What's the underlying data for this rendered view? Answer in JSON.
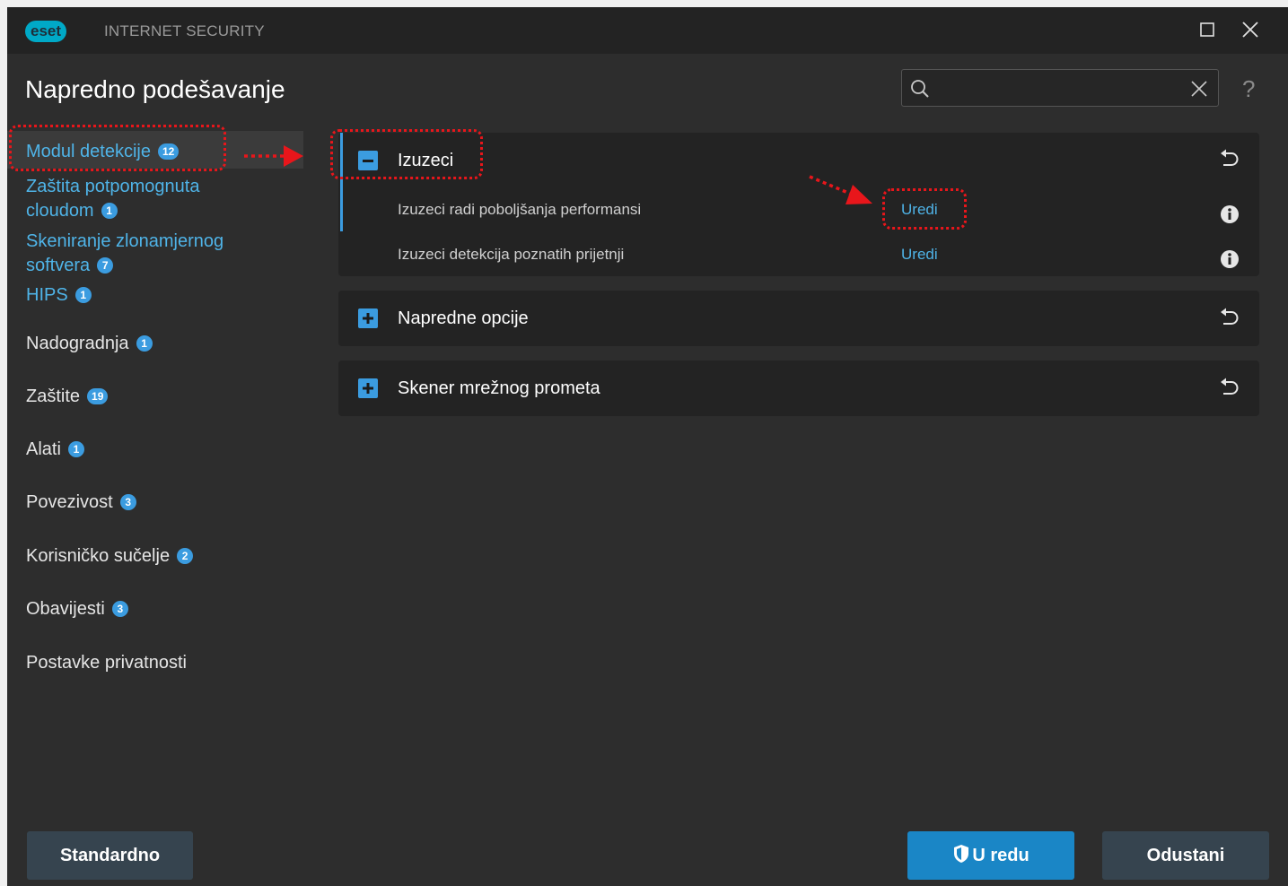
{
  "titlebar": {
    "logo_text": "eset",
    "product_name": "INTERNET SECURITY"
  },
  "header": {
    "title": "Napredno podešavanje",
    "search": {
      "value": "",
      "placeholder": ""
    },
    "help_label": "?"
  },
  "sidebar": {
    "items": [
      {
        "label": "Modul detekcije",
        "badge": "12",
        "active": true
      },
      {
        "label": "Zaštita potpomognuta",
        "label2": "cloudom",
        "badge": "1"
      },
      {
        "label": "Skeniranje zlonamjernog",
        "label2": "softvera",
        "badge": "7"
      },
      {
        "label": "HIPS",
        "badge": "1"
      },
      {
        "label": "Nadogradnja",
        "badge": "1"
      },
      {
        "label": "Zaštite",
        "badge": "19"
      },
      {
        "label": "Alati",
        "badge": "1"
      },
      {
        "label": "Povezivost",
        "badge": "3"
      },
      {
        "label": "Korisničko sučelje",
        "badge": "2"
      },
      {
        "label": "Obavijesti",
        "badge": "3"
      },
      {
        "label": "Postavke privatnosti",
        "badge": ""
      }
    ]
  },
  "sections": [
    {
      "title": "Izuzeci",
      "expanded": true,
      "rows": [
        {
          "label": "Izuzeci radi poboljšanja performansi",
          "action": "Uredi"
        },
        {
          "label": "Izuzeci detekcija poznatih prijetnji",
          "action": "Uredi"
        }
      ]
    },
    {
      "title": "Napredne opcije",
      "expanded": false
    },
    {
      "title": "Skener mrežnog prometa",
      "expanded": false
    }
  ],
  "footer": {
    "default_label": "Standardno",
    "ok_label": "U redu",
    "cancel_label": "Odustani"
  },
  "colors": {
    "accent": "#3b9ce0",
    "link": "#4fb4e8",
    "annotation": "#e8161b",
    "background": "#2d2d2d"
  }
}
